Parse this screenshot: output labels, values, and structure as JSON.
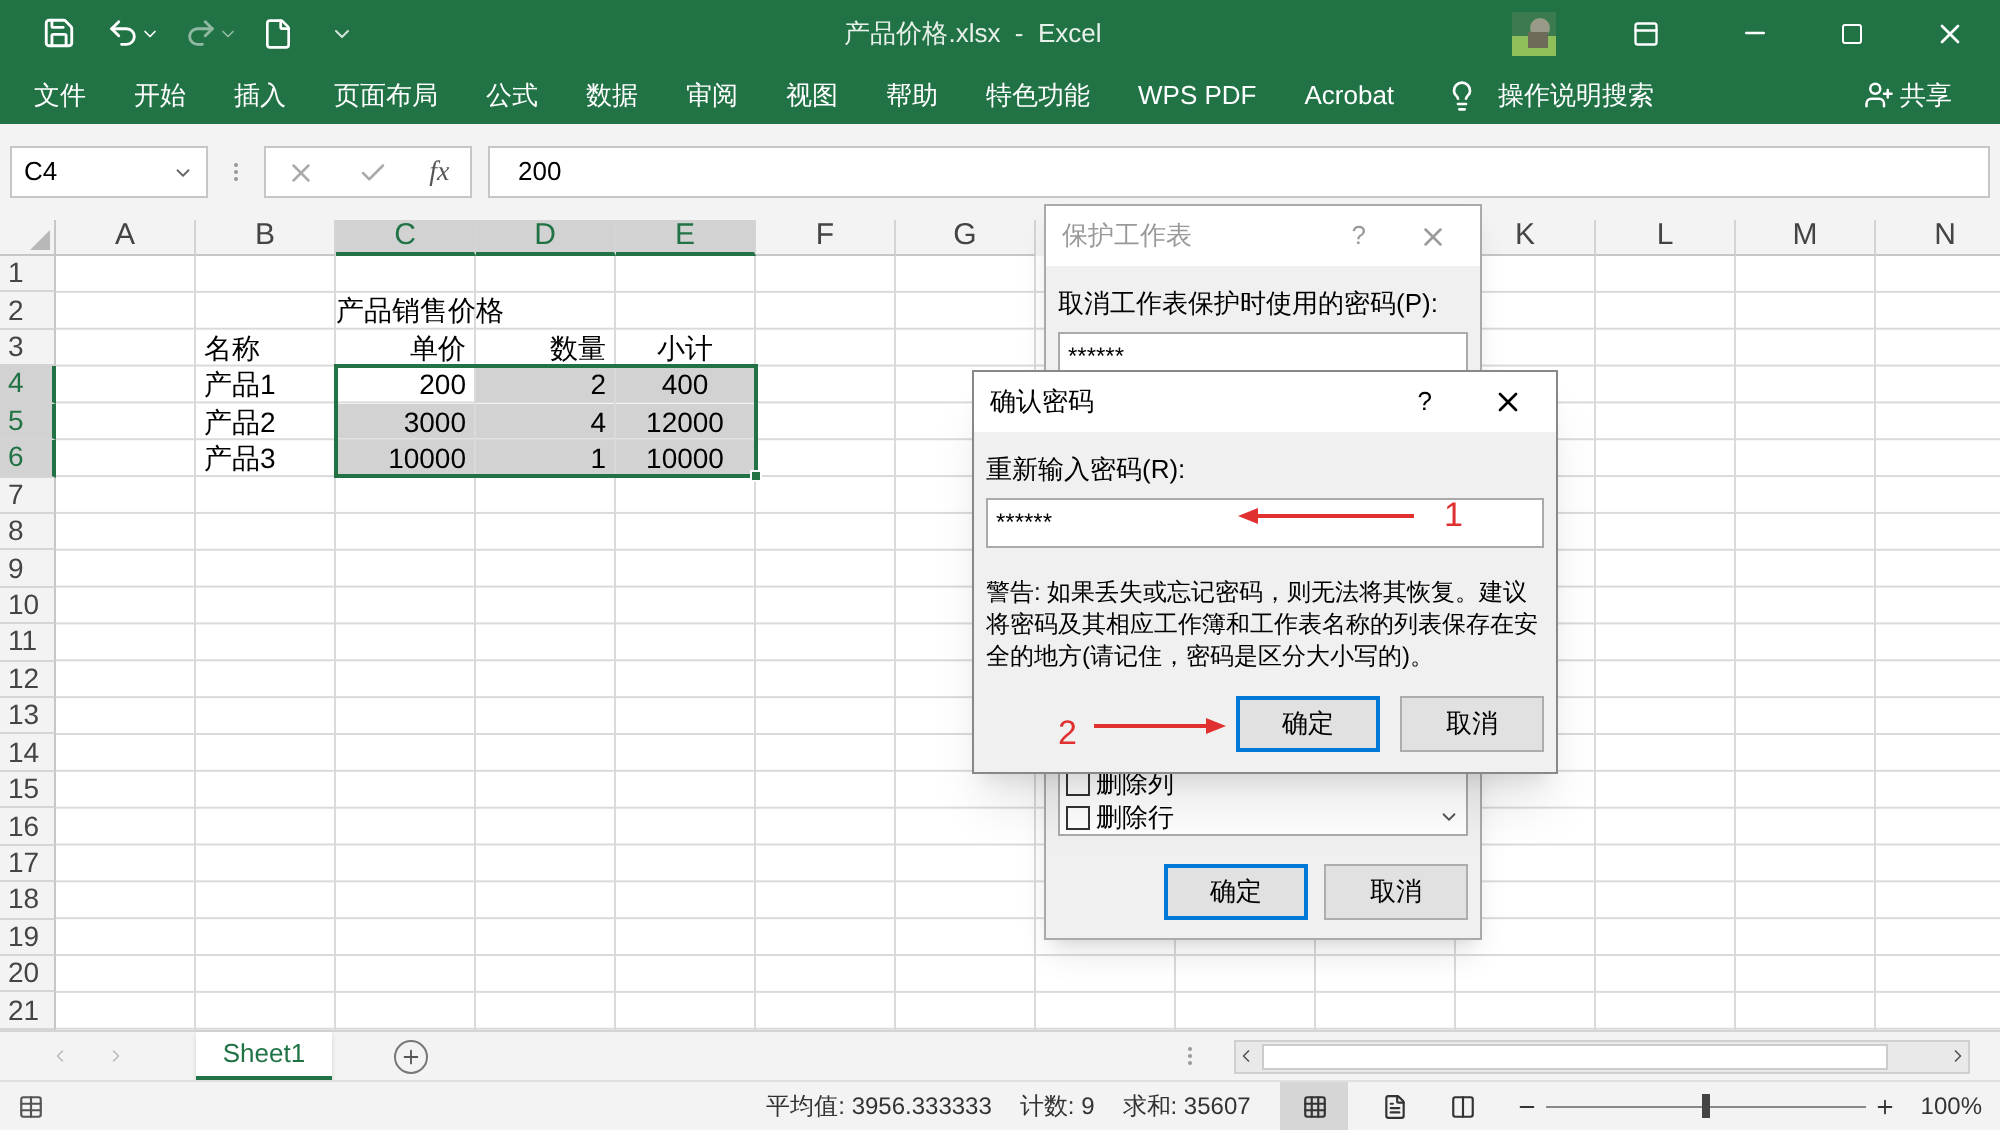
{
  "title_bar": {
    "file_title": "产品价格.xlsx  -  Excel"
  },
  "ribbon_tabs": [
    "文件",
    "开始",
    "插入",
    "页面布局",
    "公式",
    "数据",
    "审阅",
    "视图",
    "帮助",
    "特色功能",
    "WPS PDF",
    "Acrobat"
  ],
  "tell_me": "操作说明搜索",
  "share": "共享",
  "formula_bar": {
    "name_box": "C4",
    "fx": "fx",
    "value": "200"
  },
  "column_headers_left": [
    {
      "label": "A",
      "selected": false
    },
    {
      "label": "B",
      "selected": false
    },
    {
      "label": "C",
      "selected": true
    },
    {
      "label": "D",
      "selected": true
    },
    {
      "label": "E",
      "selected": true
    },
    {
      "label": "F",
      "selected": false
    },
    {
      "label": "G",
      "selected": false
    }
  ],
  "column_headers_right": [
    {
      "label": "K",
      "selected": false
    },
    {
      "label": "L",
      "selected": false
    },
    {
      "label": "M",
      "selected": false
    },
    {
      "label": "N",
      "selected": false
    }
  ],
  "rows": [
    {
      "number": "1",
      "selected": false
    },
    {
      "number": "2",
      "selected": false,
      "cells": {
        "c": "产品销售价格"
      }
    },
    {
      "number": "3",
      "selected": false,
      "cells": {
        "b": "名称",
        "c": "单价",
        "d": "数量",
        "e": "小计"
      }
    },
    {
      "number": "4",
      "selected": true,
      "cells": {
        "b": "产品1",
        "c": "200",
        "d": "2",
        "e": "400"
      }
    },
    {
      "number": "5",
      "selected": true,
      "cells": {
        "b": "产品2",
        "c": "3000",
        "d": "4",
        "e": "12000"
      }
    },
    {
      "number": "6",
      "selected": true,
      "cells": {
        "b": "产品3",
        "c": "10000",
        "d": "1",
        "e": "10000"
      }
    },
    {
      "number": "7",
      "selected": false
    },
    {
      "number": "8",
      "selected": false
    },
    {
      "number": "9",
      "selected": false
    },
    {
      "number": "10",
      "selected": false
    },
    {
      "number": "11",
      "selected": false
    },
    {
      "number": "12",
      "selected": false
    },
    {
      "number": "13",
      "selected": false
    },
    {
      "number": "14",
      "selected": false
    },
    {
      "number": "15",
      "selected": false
    },
    {
      "number": "16",
      "selected": false
    },
    {
      "number": "17",
      "selected": false
    },
    {
      "number": "18",
      "selected": false
    },
    {
      "number": "19",
      "selected": false
    },
    {
      "number": "20",
      "selected": false
    },
    {
      "number": "21",
      "selected": false
    }
  ],
  "sheet_tabs": [
    {
      "label": "Sheet1",
      "selected": true
    }
  ],
  "status_bar": {
    "average": "平均值: 3956.333333",
    "count": "计数: 9",
    "sum": "求和: 35607",
    "zoom_slider": {
      "level": 0.5
    },
    "zoom": "100%"
  },
  "protect_dialog": {
    "title": "保护工作表",
    "help": "?",
    "password_label": "取消工作表保护时使用的密码(P):",
    "password": "******",
    "permissions": [
      {
        "label": "删除列",
        "checked": false
      },
      {
        "label": "删除行",
        "checked": false
      }
    ],
    "buttons": [
      "确定",
      "取消"
    ]
  },
  "confirm_dialog": {
    "title": "确认密码",
    "help": "?",
    "label": "重新输入密码(R):",
    "password": "******",
    "warning": "警告: 如果丢失或忘记密码，则无法将其恢复。建议将密码及其相应工作簿和工作表名称的列表保存在安全的地方(请记住，密码是区分大小写的)。",
    "buttons": [
      "确定",
      "取消"
    ]
  },
  "annotations": [
    "1",
    "2"
  ]
}
